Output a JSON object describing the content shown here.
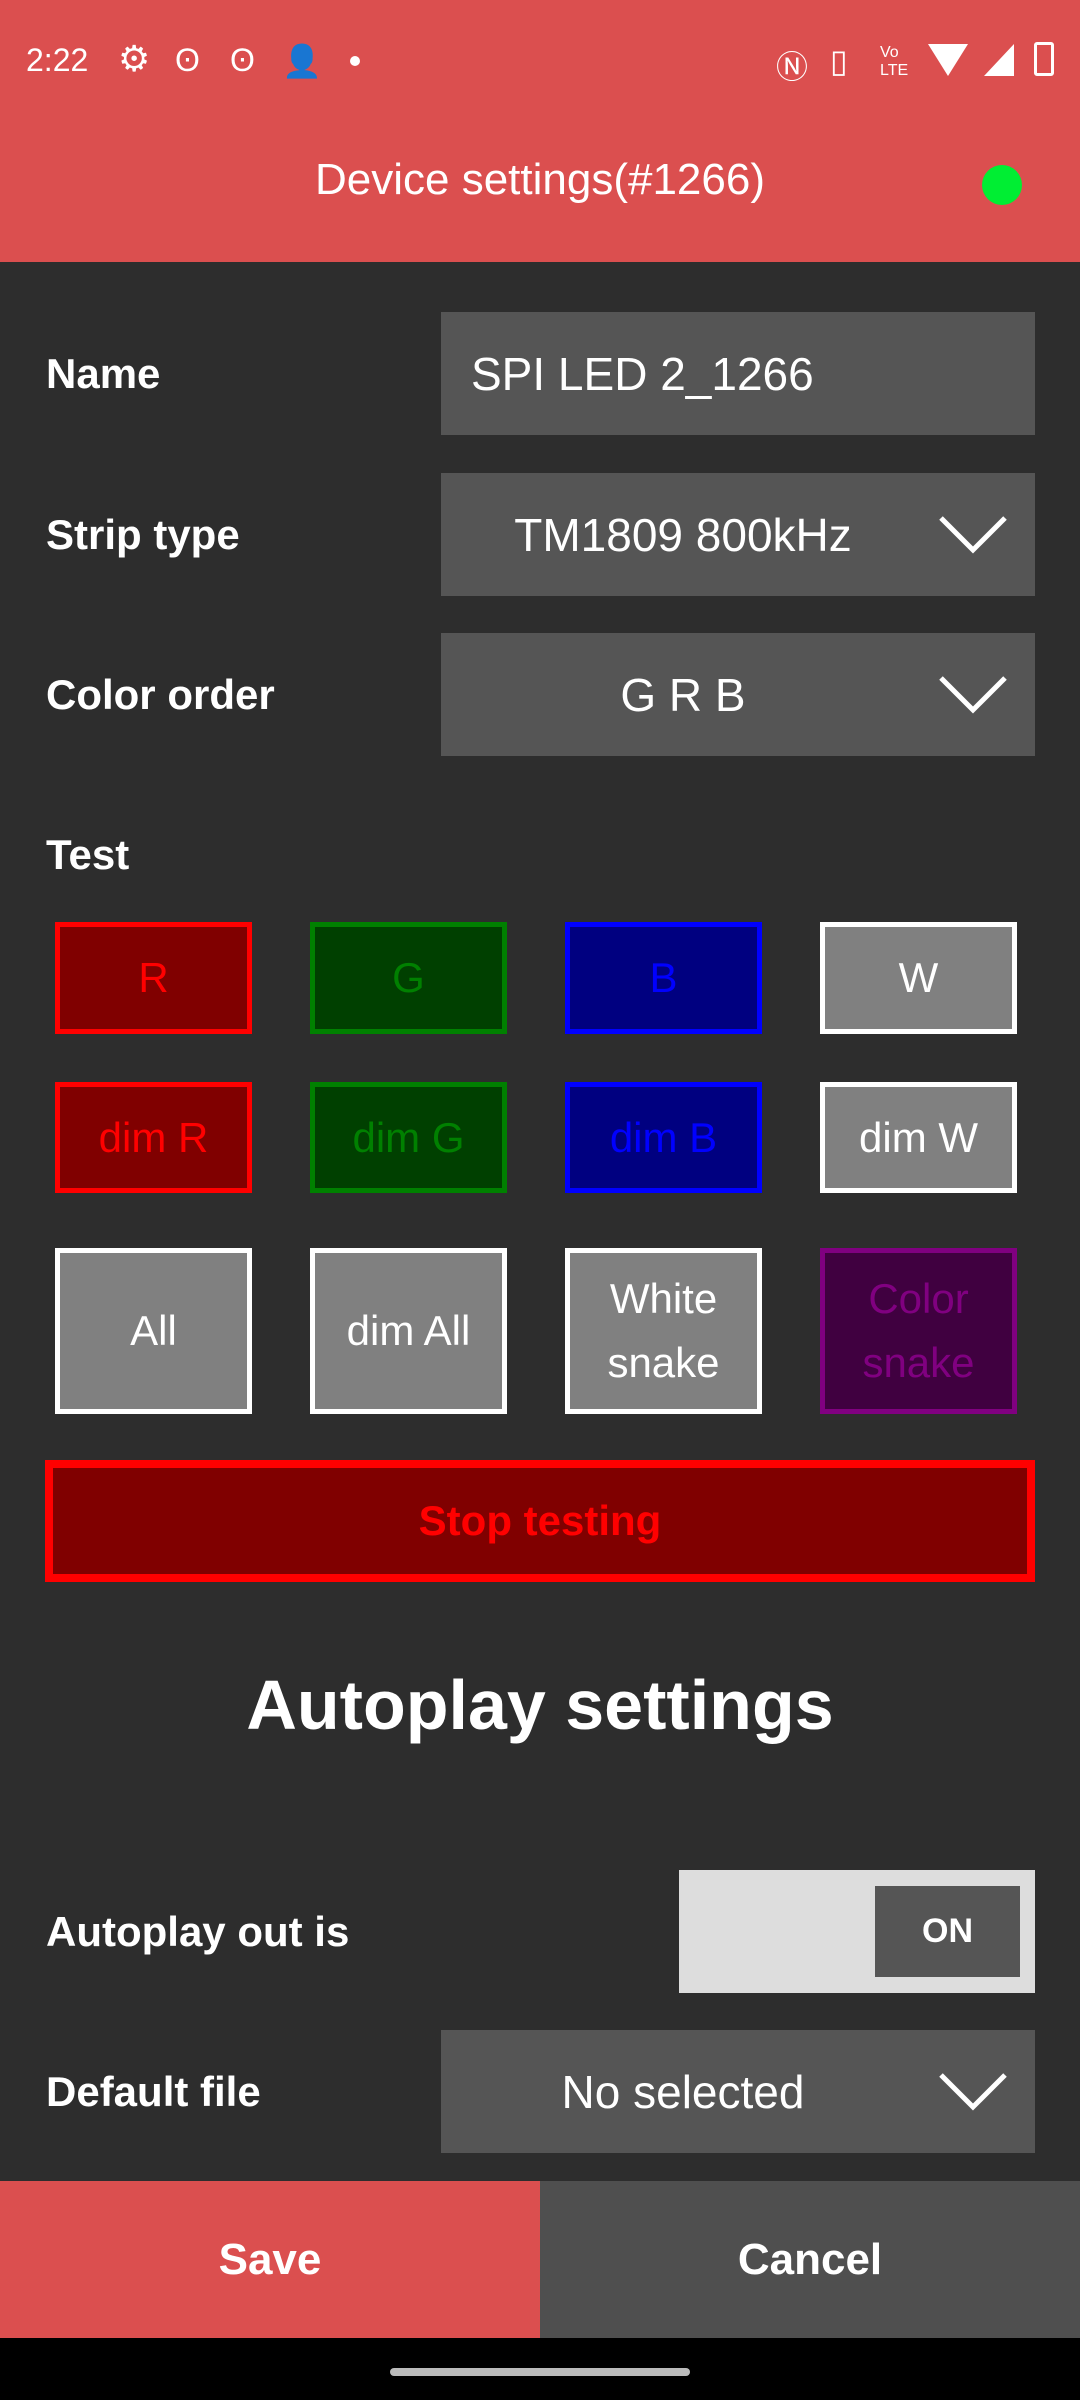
{
  "status_bar": {
    "time": "2:22",
    "left_icons": [
      "gear-icon",
      "android-icon",
      "android-icon",
      "person-add-icon",
      "dot-icon"
    ],
    "right_icons": [
      "nfc-icon",
      "vibrate-icon",
      "volte-icon",
      "wifi-icon",
      "signal-icon",
      "battery-charging-icon"
    ]
  },
  "app_bar": {
    "title": "Device settings(#1266)",
    "connection_color": "#00ee33"
  },
  "form": {
    "name": {
      "label": "Name",
      "value": "SPI LED 2_1266"
    },
    "strip_type": {
      "label": "Strip type",
      "value": "TM1809 800kHz"
    },
    "color_order": {
      "label": "Color order",
      "value": "G R B"
    }
  },
  "test": {
    "label": "Test",
    "buttons": [
      {
        "label": "R",
        "style": "r"
      },
      {
        "label": "G",
        "style": "g"
      },
      {
        "label": "B",
        "style": "b"
      },
      {
        "label": "W",
        "style": "w"
      },
      {
        "label": "dim R",
        "style": "r"
      },
      {
        "label": "dim G",
        "style": "g"
      },
      {
        "label": "dim B",
        "style": "b"
      },
      {
        "label": "dim W",
        "style": "w"
      },
      {
        "label": "All",
        "style": "w"
      },
      {
        "label": "dim All",
        "style": "w"
      },
      {
        "label": "White snake",
        "style": "w"
      },
      {
        "label": "Color snake",
        "style": "p"
      }
    ],
    "stop_label": "Stop testing"
  },
  "autoplay": {
    "heading": "Autoplay settings",
    "out_label": "Autoplay out is",
    "toggle_state": "ON",
    "default_file_label": "Default file",
    "default_file_value": "No selected"
  },
  "footer": {
    "save": "Save",
    "cancel": "Cancel"
  },
  "colors": {
    "header": "#db4f4f",
    "background": "#2d2d2d",
    "field": "#555555"
  }
}
